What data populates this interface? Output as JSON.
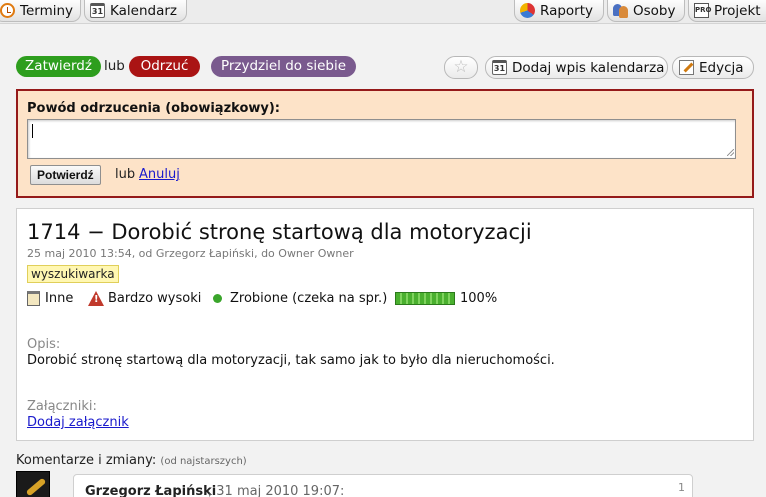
{
  "nav": {
    "items": [
      {
        "label": "Terminy",
        "icon": "clock-icon"
      },
      {
        "label": "Kalendarz",
        "icon": "calendar-icon",
        "icon_text": "31"
      },
      {
        "label": "Raporty",
        "icon": "chart-icon"
      },
      {
        "label": "Osoby",
        "icon": "people-icon"
      },
      {
        "label": "Projekt",
        "icon": "project-icon",
        "icon_text": "PRO"
      }
    ]
  },
  "actions": {
    "approve": "Zatwierdź",
    "or": "lub",
    "reject": "Odrzuć",
    "assign": "Przydziel do siebie",
    "add_calendar": "Dodaj wpis kalendarza",
    "calendar_icon_text": "31",
    "edit": "Edycja"
  },
  "rejection": {
    "label": "Powód odrzucenia (obowiązkowy):",
    "reason_value": "",
    "confirm": "Potwierdź",
    "or": "lub",
    "cancel": "Anuluj"
  },
  "task": {
    "title": "1714 − Dorobić stronę startową dla motoryzacji",
    "meta": "25 maj 2010 13:54, od Grzegorz Łapiński, do Owner Owner",
    "tag": "wyszukiwarka",
    "type": "Inne",
    "priority": "Bardzo wysoki",
    "status": "Zrobione (czeka na spr.)",
    "progress_percent": 100,
    "progress_label": "100%",
    "description_label": "Opis:",
    "description": "Dorobić stronę startową dla motoryzacji, tak samo jak to było dla nieruchomości.",
    "attachments_label": "Załączniki:",
    "add_attachment": "Dodaj załącznik"
  },
  "comments": {
    "heading": "Komentarze i zmiany:",
    "order_note": "(od najstarszych)",
    "items": [
      {
        "author": "Grzegorz Łapiński",
        "date": ", 31 maj 2010 19:07:",
        "number": "1"
      }
    ]
  },
  "colors": {
    "approve": "#2e9e1e",
    "reject": "#aa1414",
    "assign": "#7a5a8e",
    "rejection_panel_bg": "#fde3c8",
    "rejection_panel_border": "#951a1a",
    "link": "#1a1acc"
  }
}
